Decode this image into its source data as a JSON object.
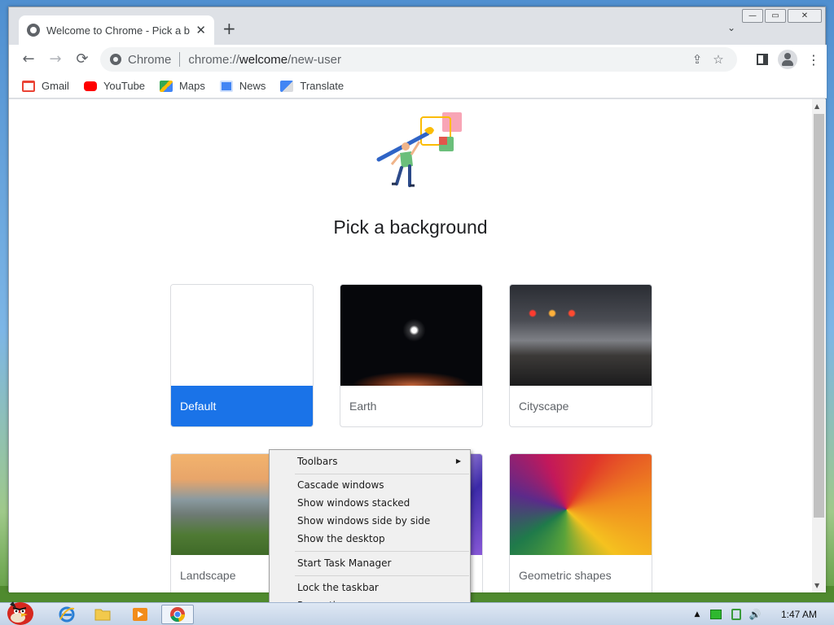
{
  "browser": {
    "tab": {
      "title": "Welcome to Chrome - Pick a b",
      "close_glyph": "✕"
    },
    "new_tab_glyph": "+",
    "tab_search_glyph": "⌄",
    "window_buttons": {
      "minimize": "—",
      "maximize": "▭",
      "close": "✕"
    },
    "nav": {
      "back": "←",
      "forward": "→",
      "reload": "⟳"
    },
    "omnibox": {
      "site_name": "Chrome",
      "url_scheme": "chrome://",
      "url_host": "welcome",
      "url_path": "/new-user"
    },
    "omnibox_actions": {
      "share": "⇪",
      "bookmark": "☆"
    },
    "menu_glyph": "⋮",
    "bookmarks": [
      {
        "label": "Gmail",
        "icon": "gmail-icon",
        "color": "#ea4335"
      },
      {
        "label": "YouTube",
        "icon": "youtube-icon",
        "color": "#ff0000"
      },
      {
        "label": "Maps",
        "icon": "maps-icon",
        "color": "#34a853"
      },
      {
        "label": "News",
        "icon": "news-icon",
        "color": "#4285f4"
      },
      {
        "label": "Translate",
        "icon": "translate-icon",
        "color": "#4285f4"
      }
    ]
  },
  "page": {
    "heading": "Pick a background",
    "backgrounds": [
      {
        "label": "Default",
        "selected": true
      },
      {
        "label": "Earth",
        "selected": false
      },
      {
        "label": "Cityscape",
        "selected": false
      },
      {
        "label": "Landscape",
        "selected": false
      },
      {
        "label": "",
        "selected": false
      },
      {
        "label": "Geometric shapes",
        "selected": false
      }
    ],
    "accent_color": "#1a73e8"
  },
  "context_menu": {
    "toolbars": "Toolbars",
    "cascade": "Cascade windows",
    "stacked": "Show windows stacked",
    "side_by_side": "Show windows side by side",
    "show_desktop": "Show the desktop",
    "task_manager": "Start Task Manager",
    "lock_taskbar": "Lock the taskbar",
    "properties": "Properties",
    "submenu_arrow": "▶"
  },
  "taskbar": {
    "clock": "1:47 AM",
    "tray_expand": "▲",
    "volume_icon": "🔊"
  }
}
